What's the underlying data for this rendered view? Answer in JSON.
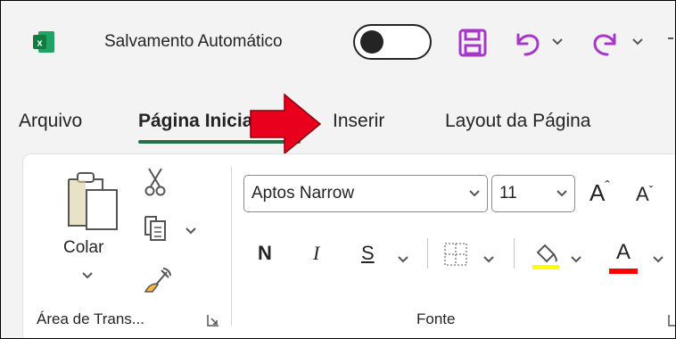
{
  "titlebar": {
    "autosave_label": "Salvamento Automático",
    "autosave_state": "off",
    "icons": [
      "excel-icon",
      "save-icon",
      "undo-icon",
      "redo-icon"
    ]
  },
  "tabs": [
    {
      "label": "Arquivo",
      "active": false
    },
    {
      "label": "Página Inicial",
      "active": true
    },
    {
      "label": "Inserir",
      "active": false
    },
    {
      "label": "Layout da Página",
      "active": false
    }
  ],
  "clipboard": {
    "paste_label": "Colar",
    "group_label": "Área de Trans..."
  },
  "font": {
    "font_name": "Aptos Narrow",
    "font_size": "11",
    "bold_label": "N",
    "italic_label": "I",
    "underline_label": "S",
    "font_color_label": "A",
    "grow_label": "A",
    "shrink_label": "A",
    "group_label": "Fonte",
    "fill_color": "#ffff00",
    "text_color": "#ff0000"
  },
  "colors": {
    "accent": "#217346",
    "annotation_arrow": "#e8001c"
  }
}
